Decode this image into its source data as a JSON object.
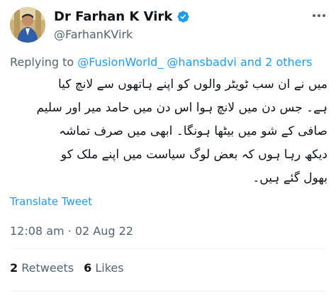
{
  "author": {
    "display_name": "Dr Farhan K Virk",
    "handle": "@FarhanKVirk",
    "verified_icon": "verified-badge-icon",
    "avatar_icon": "avatar"
  },
  "reply": {
    "prefix": "Replying to",
    "users": [
      "@FusionWorld_",
      "@hansbadvi"
    ],
    "and_text": "and",
    "others": "2 others"
  },
  "tweet": {
    "lines": [
      "میں نے ان سب ٹویٹر والوں کو اپنے ہاتھوں سے لانچ کیا",
      "ہے۔ جس دن میں لانچ ہوا اس دن میں حامد میر اور سلیم",
      "صافی کے شو میں بیٹھا ہونگا۔ ابھی میں صرف تماشہ",
      "دیکھ رہا ہوں کہ بعض لوگ سیاست میں اپنے ملک کو",
      "بھول گئے ہیں۔"
    ],
    "translate_label": "Translate Tweet",
    "timestamp": "12:08 am · 02 Aug 22"
  },
  "stats": {
    "retweets_count": "2",
    "retweets_label": "Retweets",
    "likes_count": "6",
    "likes_label": "Likes"
  },
  "colors": {
    "link": "#1d9bf0",
    "secondary": "#536471",
    "text": "#0f1419"
  }
}
